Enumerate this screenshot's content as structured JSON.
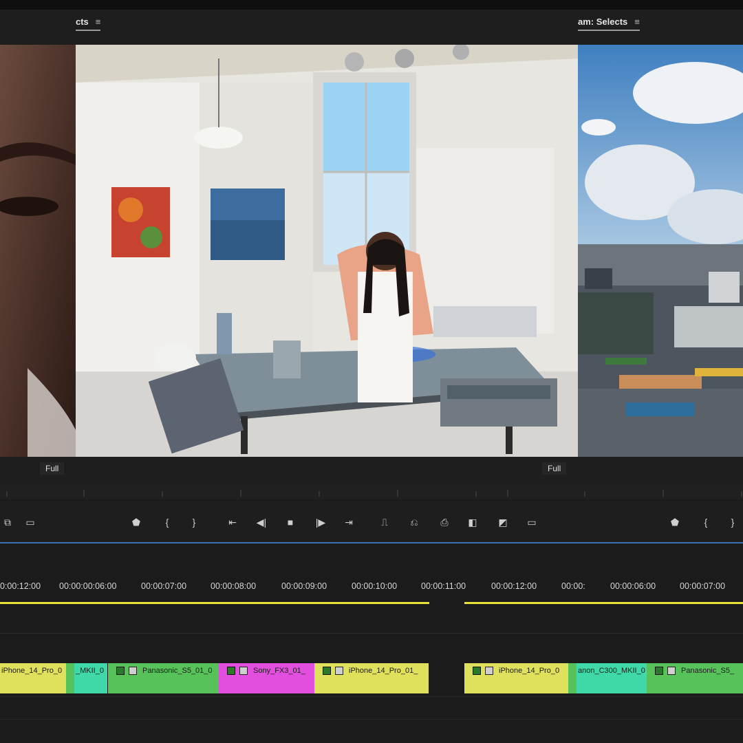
{
  "panels": {
    "left_tab_label": "cts",
    "right_tab_label": "am: Selects",
    "left_zoom": "Full",
    "right_zoom": "Full"
  },
  "timeline": {
    "timecodes": [
      "0:00:12:00",
      "00:00:00:06:00",
      "00:00:07:00",
      "00:00:08:00",
      "00:00:09:00",
      "00:00:10:00",
      "00:00:11:00",
      "00:00:12:00",
      "00:00:",
      "00:00:06:00",
      "00:00:07:00"
    ],
    "clips": [
      {
        "label": "iPhone_14_Pro_0",
        "color": "#dfe05c"
      },
      {
        "label": "_MKII_0",
        "color": "#3fd8a8"
      },
      {
        "label": "Panasonic_S5_01_0",
        "color": "#58c25a"
      },
      {
        "label": "Sony_FX3_01_",
        "color": "#e24fdf"
      },
      {
        "label": "iPhone_14_Pro_01_",
        "color": "#dfe05c"
      },
      {
        "label": "iPhone_14_Pro_0",
        "color": "#dfe05c"
      },
      {
        "label": "anon_C300_MKII_0",
        "color": "#3fd8a8"
      },
      {
        "label": "Panasonic_S5_",
        "color": "#58c25a"
      }
    ]
  },
  "icons": [
    "marker-icon",
    "mark-in-icon",
    "mark-out-icon",
    "go-to-in-icon",
    "step-back-icon",
    "stop-icon",
    "step-forward-icon",
    "go-to-out-icon",
    "insert-icon",
    "overwrite-icon",
    "camera-icon",
    "compare-icon",
    "settings-icon",
    "multicam-icon"
  ]
}
